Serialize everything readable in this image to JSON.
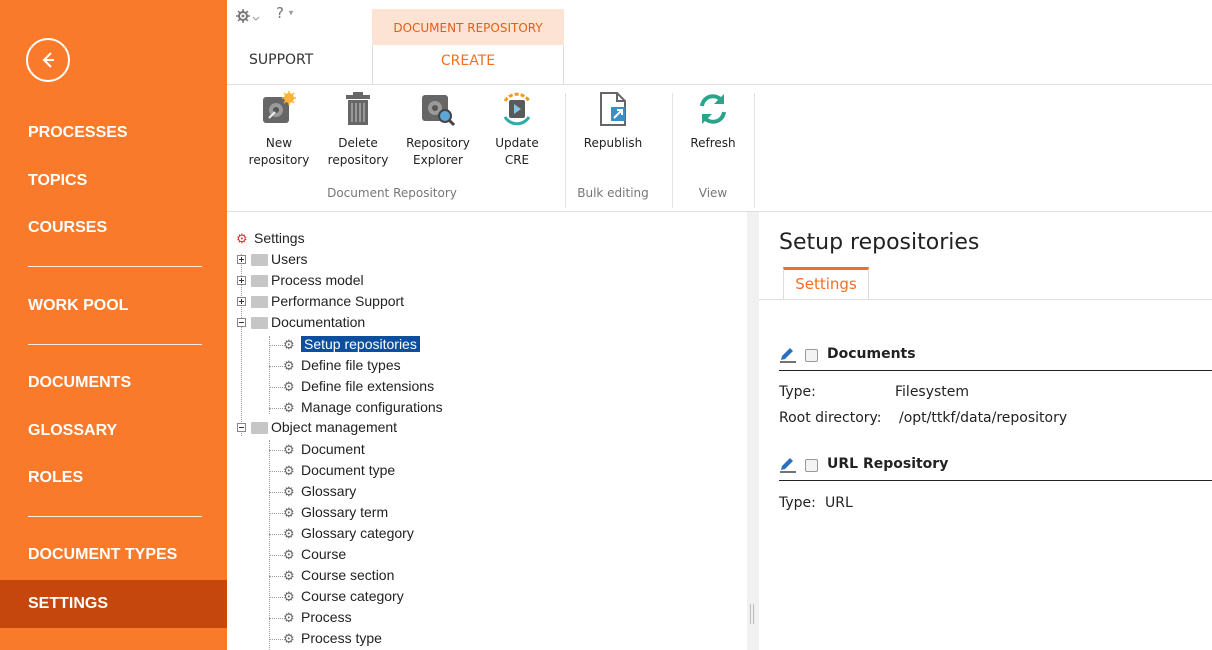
{
  "sidebar": {
    "back_icon": "arrow-left-icon",
    "items": [
      {
        "label": "PROCESSES"
      },
      {
        "label": "TOPICS"
      },
      {
        "label": "COURSES"
      },
      {
        "label": "WORK POOL"
      },
      {
        "label": "DOCUMENTS"
      },
      {
        "label": "GLOSSARY"
      },
      {
        "label": "ROLES"
      },
      {
        "label": "DOCUMENT TYPES"
      },
      {
        "label": "SETTINGS"
      }
    ],
    "active": "SETTINGS",
    "colors": {
      "bg": "#f97a2a",
      "active_bg": "#c5470d"
    }
  },
  "quick_access": {
    "settings_icon": "gear-icon",
    "help_icon": "question-icon",
    "help_glyph": "?"
  },
  "ribbon": {
    "context_tab": "DOCUMENT REPOSITORY",
    "tabs": [
      {
        "label": "SUPPORT"
      },
      {
        "label": "CREATE"
      }
    ],
    "active_tab": "CREATE",
    "buttons": {
      "new_repository": {
        "line1": "New",
        "line2": "repository"
      },
      "delete_repository": {
        "line1": "Delete",
        "line2": "repository"
      },
      "repository_explorer": {
        "line1": "Repository",
        "line2": "Explorer"
      },
      "update_cre": {
        "line1": "Update",
        "line2": "CRE"
      },
      "republish": {
        "line1": "Republish"
      },
      "refresh": {
        "line1": "Refresh"
      }
    },
    "groups": {
      "document_repository": "Document Repository",
      "bulk_editing": "Bulk editing",
      "view": "View"
    }
  },
  "tree": {
    "root": "Settings",
    "users": "Users",
    "process_model": "Process model",
    "performance_support": "Performance Support",
    "documentation": "Documentation",
    "documentation_children": [
      "Setup repositories",
      "Define file types",
      "Define file extensions",
      "Manage configurations"
    ],
    "object_management": "Object management",
    "object_children": [
      "Document",
      "Document type",
      "Glossary",
      "Glossary term",
      "Glossary category",
      "Course",
      "Course section",
      "Course category",
      "Process",
      "Process type"
    ],
    "selected": "Setup repositories"
  },
  "content": {
    "title": "Setup repositories",
    "tab": "Settings",
    "sections": [
      {
        "name": "Documents",
        "fields": [
          {
            "key": "Type:",
            "value": "Filesystem"
          },
          {
            "key": "Root directory:",
            "value": "/opt/ttkf/data/repository"
          }
        ]
      },
      {
        "name": "URL Repository",
        "fields": [
          {
            "key": "Type:",
            "value": "URL"
          }
        ]
      }
    ],
    "accent": "#f37021"
  }
}
